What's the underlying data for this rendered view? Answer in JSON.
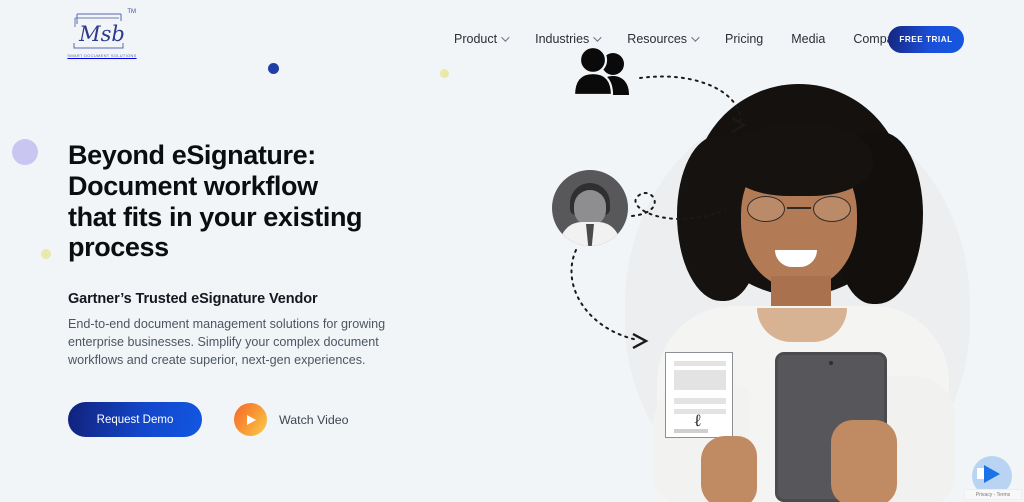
{
  "brand": {
    "monogram": "Msb",
    "trademark": "TM",
    "tagline": "SMART DOCUMENT SOLUTIONS"
  },
  "nav": {
    "items": [
      {
        "label": "Product",
        "has_dropdown": true
      },
      {
        "label": "Industries",
        "has_dropdown": true
      },
      {
        "label": "Resources",
        "has_dropdown": true
      },
      {
        "label": "Pricing",
        "has_dropdown": false
      },
      {
        "label": "Media",
        "has_dropdown": false
      },
      {
        "label": "Company",
        "has_dropdown": true
      }
    ],
    "cta_label": "FREE TRIAL"
  },
  "hero": {
    "headline_line1": "Beyond eSignature:",
    "headline_line2": "Document workflow",
    "headline_line3": "that fits in your existing",
    "headline_line4": "process",
    "subheading": "Gartner’s Trusted eSignature Vendor",
    "body": "End-to-end document management solutions for growing enterprise businesses. Simplify your complex document workflows and create superior, next-gen experiences.",
    "primary_cta": "Request Demo",
    "secondary_cta": "Watch Video"
  },
  "illustration": {
    "users_icon": "users-group-icon",
    "avatar_icon": "person-avatar-icon",
    "document_card": "signed-document-icon",
    "signature_glyph": "ℓ",
    "tablet": "tablet-device"
  },
  "recaptcha": {
    "label": "Privacy - Terms"
  },
  "colors": {
    "page_background": "#f2f5f8",
    "cta_gradient_start": "#11217a",
    "cta_gradient_end": "#1257e2",
    "play_gradient_start": "#f4682a",
    "play_gradient_end": "#f7cf4a",
    "headline": "#0b0d10",
    "body_text": "#4b5563",
    "dot_navy": "#1f3fa8",
    "dot_yellow": "#e7e9ae",
    "dot_lavender": "#c9c6f2"
  }
}
